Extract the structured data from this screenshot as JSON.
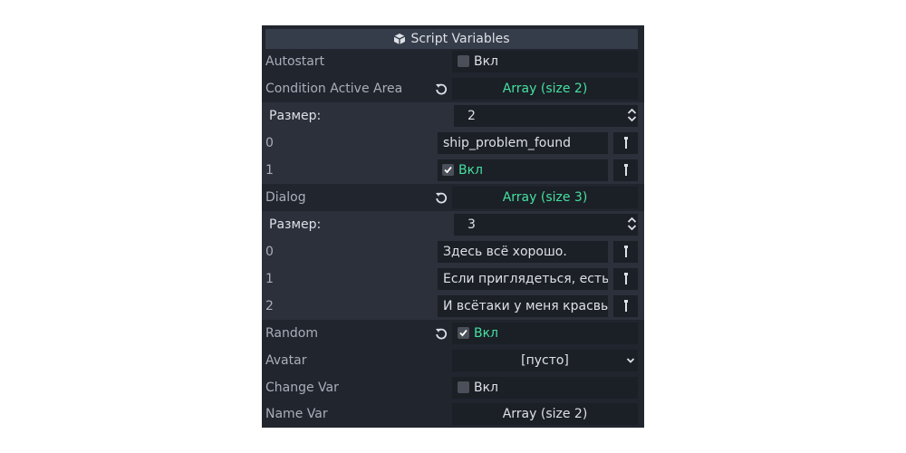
{
  "header": {
    "title": "Script Variables",
    "icon": "cube-icon"
  },
  "colors": {
    "accent": "#45e0a0",
    "label": "#a9aeb8",
    "text": "#dde0e6",
    "panel": "#20252e",
    "field": "#1b1f26"
  },
  "props": {
    "autostart": {
      "label": "Autostart",
      "toggle": "Вкл",
      "checked": false
    },
    "condition_active_area": {
      "label": "Condition Active Area",
      "value": "Array (size 2)",
      "size_label": "Размер:",
      "size": "2",
      "items": [
        {
          "index": "0",
          "value": "ship_problem_found"
        },
        {
          "index": "1",
          "value": "Вкл",
          "checked": true
        }
      ]
    },
    "dialog": {
      "label": "Dialog",
      "value": "Array (size 3)",
      "size_label": "Размер:",
      "size": "3",
      "items": [
        {
          "index": "0",
          "value": "Здесь всё хорошо."
        },
        {
          "index": "1",
          "value": "Если приглядеться, есть"
        },
        {
          "index": "2",
          "value": "И всётаки у меня красвы"
        }
      ]
    },
    "random": {
      "label": "Random",
      "toggle": "Вкл",
      "checked": true
    },
    "avatar": {
      "label": "Avatar",
      "value": "[пусто]"
    },
    "change_var": {
      "label": "Change Var",
      "toggle": "Вкл",
      "checked": false
    },
    "name_var": {
      "label": "Name Var",
      "value": "Array (size 2)"
    }
  }
}
